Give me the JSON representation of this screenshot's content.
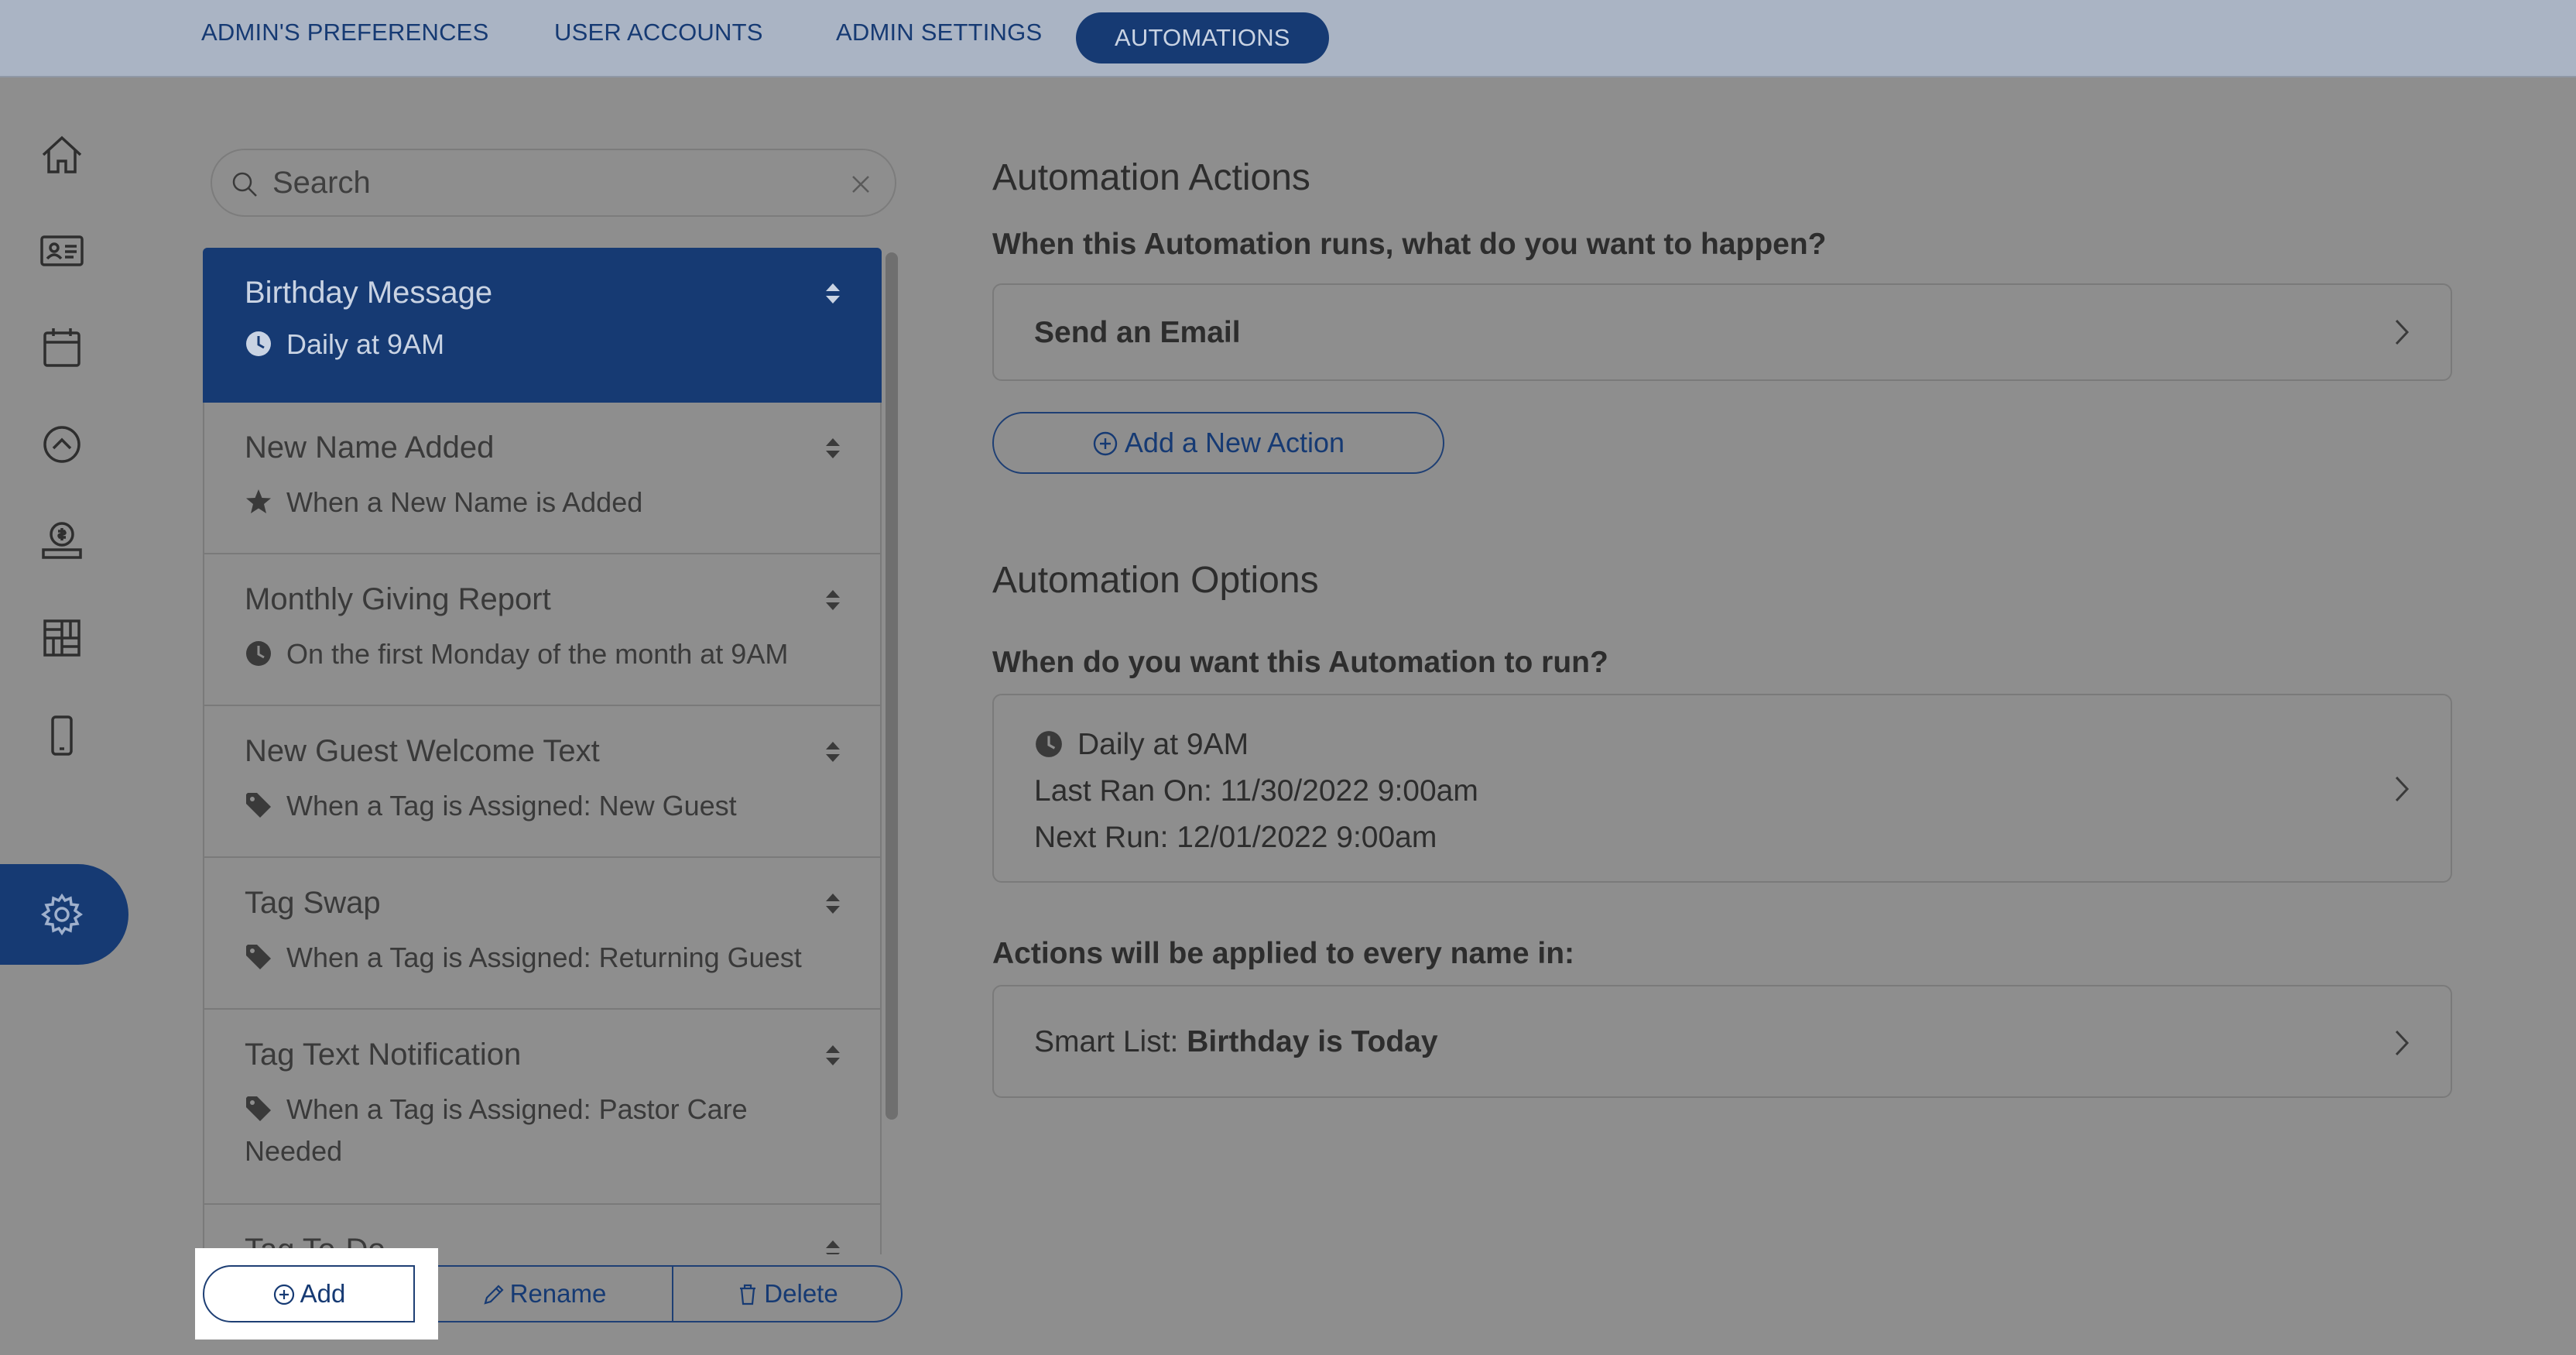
{
  "topnav": {
    "tabs": [
      {
        "label": "ADMIN'S PREFERENCES"
      },
      {
        "label": "USER ACCOUNTS"
      },
      {
        "label": "ADMIN SETTINGS"
      },
      {
        "label": "AUTOMATIONS",
        "active": true
      }
    ]
  },
  "sidebar": {
    "items": [
      {
        "icon": "home-icon"
      },
      {
        "icon": "contact-card-icon"
      },
      {
        "icon": "calendar-icon"
      },
      {
        "icon": "up-circle-icon"
      },
      {
        "icon": "giving-icon"
      },
      {
        "icon": "grid-icon"
      },
      {
        "icon": "mobile-icon"
      },
      {
        "icon": "gear-icon",
        "active": true
      }
    ]
  },
  "search": {
    "placeholder": "Search"
  },
  "automations": [
    {
      "title": "Birthday Message",
      "trigger": "Daily at 9AM",
      "icon": "clock-icon",
      "selected": true
    },
    {
      "title": "New Name Added",
      "trigger": "When a New Name is Added",
      "icon": "star-icon"
    },
    {
      "title": "Monthly Giving Report",
      "trigger": "On the first Monday of the month at 9AM",
      "icon": "clock-icon"
    },
    {
      "title": "New Guest Welcome Text",
      "trigger": "When a Tag is Assigned: New Guest",
      "icon": "tag-icon"
    },
    {
      "title": "Tag Swap",
      "trigger": "When a Tag is Assigned: Returning Guest",
      "icon": "tag-icon"
    },
    {
      "title": "Tag Text Notification",
      "trigger": "When a Tag is Assigned: Pastor Care Needed",
      "icon": "tag-icon"
    },
    {
      "title": "Tag To-Do",
      "trigger": "",
      "icon": "tag-icon"
    }
  ],
  "list_buttons": {
    "add": "Add",
    "rename": "Rename",
    "delete": "Delete"
  },
  "actions_section": {
    "heading": "Automation Actions",
    "question": "When this Automation runs, what do you want to happen?",
    "action_card": "Send an Email",
    "add_action": "Add a New Action"
  },
  "options_section": {
    "heading": "Automation Options",
    "question": "When do you want this Automation to run?",
    "schedule": "Daily at 9AM",
    "last_ran": "Last Ran On: 11/30/2022 9:00am",
    "next_run": "Next Run: 12/01/2022 9:00am",
    "apply_question": "Actions will be applied to every name in:",
    "smart_list_label": "Smart List:",
    "smart_list_value": "Birthday is Today"
  },
  "colors": {
    "accent": "#163a73",
    "overlay_bg": "#8e8e8e",
    "highlight": "#ffffff"
  }
}
